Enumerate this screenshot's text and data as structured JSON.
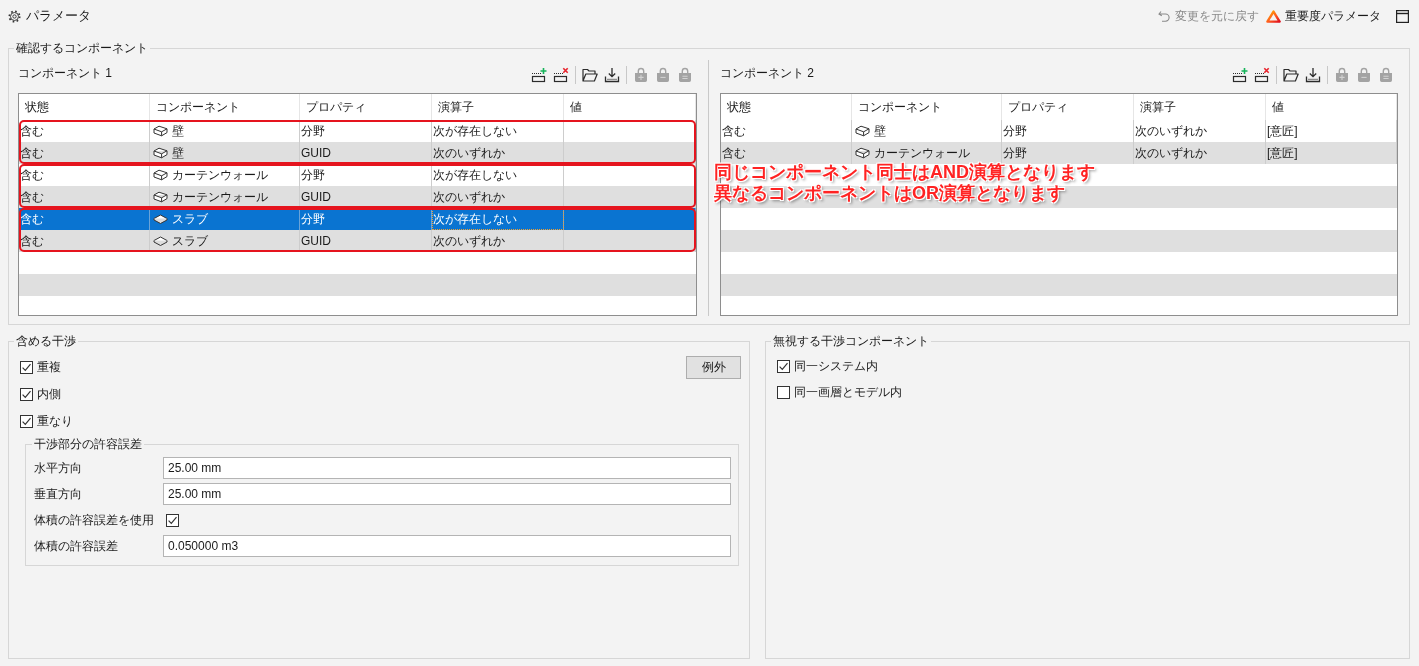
{
  "header": {
    "title": "パラメータ",
    "undo": {
      "label": "変更を元に戻す",
      "disabled": true
    },
    "severity": {
      "label": "重要度パラメータ"
    }
  },
  "components_group": {
    "legend": "確認するコンポーネント",
    "annotation": {
      "lines": [
        "同じコンポーネント同士はAND演算となります",
        "異なるコンポーネントはOR演算となります"
      ]
    },
    "panels": [
      {
        "title": "コンポーネント 1",
        "toolbar": [
          [
            {
              "kind": "add_row",
              "disabled": false
            },
            {
              "kind": "remove_row",
              "disabled": false
            }
          ],
          [
            {
              "kind": "open",
              "disabled": false
            },
            {
              "kind": "import",
              "disabled": false
            }
          ],
          [
            {
              "kind": "bag_plus",
              "disabled": true
            },
            {
              "kind": "bag_minus",
              "disabled": true
            },
            {
              "kind": "bag_equal",
              "disabled": true
            }
          ]
        ],
        "columns": [
          "状態",
          "コンポーネント",
          "プロパティ",
          "演算子",
          "値"
        ],
        "groups": [
          {
            "outlined": true,
            "rows": [
              {
                "kind": "block",
                "status": "含む",
                "component": "壁",
                "property": "分野",
                "operator": "次が存在しない",
                "selected": false
              },
              {
                "kind": "block",
                "status": "含む",
                "component": "壁",
                "property": "GUID",
                "operator": "次のいずれか",
                "selected": false
              }
            ]
          },
          {
            "outlined": true,
            "rows": [
              {
                "kind": "block",
                "status": "含む",
                "component": "カーテンウォール",
                "property": "分野",
                "operator": "次が存在しない",
                "selected": false
              },
              {
                "kind": "block",
                "status": "含む",
                "component": "カーテンウォール",
                "property": "GUID",
                "operator": "次のいずれか",
                "selected": false
              }
            ]
          },
          {
            "outlined": true,
            "rows": [
              {
                "kind": "slab",
                "status": "含む",
                "component": "スラブ",
                "property": "分野",
                "operator": "次が存在しない",
                "selected": true
              },
              {
                "kind": "slab",
                "status": "含む",
                "component": "スラブ",
                "property": "GUID",
                "operator": "次のいずれか",
                "selected": false
              }
            ]
          }
        ]
      },
      {
        "title": "コンポーネント 2",
        "toolbar": [
          [
            {
              "kind": "add_row",
              "disabled": false
            },
            {
              "kind": "remove_row",
              "disabled": false
            }
          ],
          [
            {
              "kind": "open",
              "disabled": false
            },
            {
              "kind": "import",
              "disabled": false
            }
          ],
          [
            {
              "kind": "bag_plus",
              "disabled": true
            },
            {
              "kind": "bag_minus",
              "disabled": true
            },
            {
              "kind": "bag_equal",
              "disabled": true
            }
          ]
        ],
        "columns": [
          "状態",
          "コンポーネント",
          "プロパティ",
          "演算子",
          "値"
        ],
        "groups": [
          {
            "outlined": false,
            "rows": [
              {
                "kind": "block",
                "status": "含む",
                "component": "壁",
                "property": "分野",
                "operator": "次のいずれか",
                "value": "[意匠]",
                "selected": false
              }
            ]
          },
          {
            "outlined": false,
            "rows": [
              {
                "kind": "block",
                "status": "含む",
                "component": "カーテンウォール",
                "property": "分野",
                "operator": "次のいずれか",
                "value": "[意匠]",
                "selected": false
              }
            ]
          }
        ]
      }
    ]
  },
  "include_group": {
    "legend": "含める干渉",
    "checks": [
      {
        "label": "重複",
        "checked": true
      },
      {
        "label": "内側",
        "checked": true
      },
      {
        "label": "重なり",
        "checked": true
      }
    ],
    "exceptions_button": "例外",
    "tolerance": {
      "legend": "干渉部分の許容誤差",
      "rows": [
        {
          "kind": "field",
          "label": "水平方向",
          "value": "25.00 mm"
        },
        {
          "kind": "field",
          "label": "垂直方向",
          "value": "25.00 mm"
        },
        {
          "kind": "check",
          "label": "体積の許容誤差を使用",
          "checked": true
        },
        {
          "kind": "field",
          "label": "体積の許容誤差",
          "value": "0.050000 m3"
        }
      ]
    }
  },
  "ignore_group": {
    "legend": "無視する干渉コンポーネント",
    "checks": [
      {
        "label": "同一システム内",
        "checked": true
      },
      {
        "label": "同一画層とモデル内",
        "checked": false
      }
    ]
  }
}
